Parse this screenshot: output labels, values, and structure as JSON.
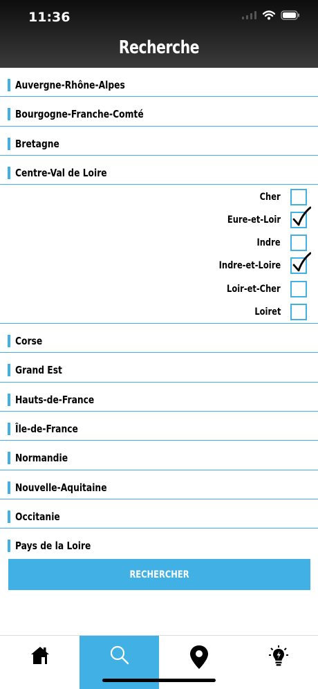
{
  "status_bar": {
    "time": "11:36"
  },
  "header": {
    "title": "Recherche"
  },
  "regions_top": [
    {
      "label": "Auvergne-Rhône-Alpes"
    },
    {
      "label": "Bourgogne-Franche-Comté"
    },
    {
      "label": "Bretagne"
    },
    {
      "label": "Centre-Val de Loire"
    }
  ],
  "departments": [
    {
      "label": "Cher",
      "checked": false
    },
    {
      "label": "Eure-et-Loir",
      "checked": true
    },
    {
      "label": "Indre",
      "checked": false
    },
    {
      "label": "Indre-et-Loire",
      "checked": true
    },
    {
      "label": "Loir-et-Cher",
      "checked": false
    },
    {
      "label": "Loiret",
      "checked": false
    }
  ],
  "regions_bottom": [
    {
      "label": "Corse"
    },
    {
      "label": "Grand Est"
    },
    {
      "label": "Hauts-de-France"
    },
    {
      "label": "Île-de-France"
    },
    {
      "label": "Normandie"
    },
    {
      "label": "Nouvelle-Aquitaine"
    },
    {
      "label": "Occitanie"
    },
    {
      "label": "Pays de la Loire"
    }
  ],
  "search_button": {
    "label": "RECHERCHER"
  },
  "tabs": [
    {
      "icon": "home-icon",
      "active": false
    },
    {
      "icon": "search-icon",
      "active": true
    },
    {
      "icon": "map-pin-icon",
      "active": false
    },
    {
      "icon": "lightbulb-icon",
      "active": false
    }
  ],
  "colors": {
    "accent": "#41b0e4",
    "header_dark": "#1a1a1a"
  }
}
